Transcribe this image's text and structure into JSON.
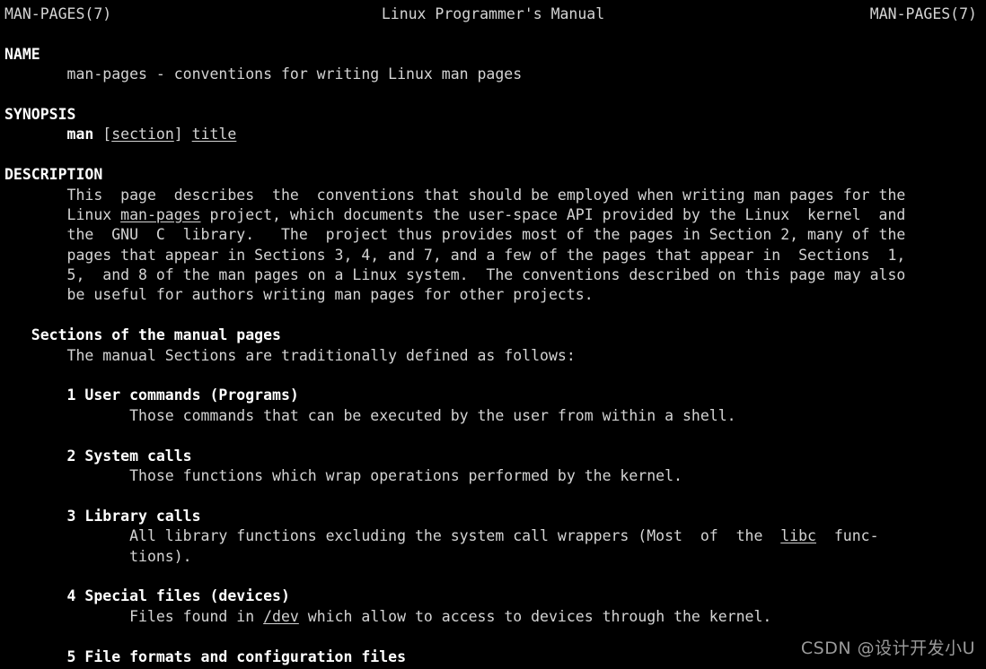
{
  "terminal": {
    "background_color": "#000000",
    "text_color": "#d4d4d4",
    "bold_color": "#ffffff"
  },
  "header": {
    "left": "MAN-PAGES(7)",
    "center": "Linux Programmer's Manual",
    "right": "MAN-PAGES(7)"
  },
  "sections": {
    "name_heading": "NAME",
    "name_body": "       man-pages - conventions for writing Linux man pages",
    "synopsis_heading": "SYNOPSIS",
    "synopsis_man": "man",
    "synopsis_bracket_open": " [",
    "synopsis_section": "section",
    "synopsis_bracket_close": "] ",
    "synopsis_title": "title",
    "description_heading": "DESCRIPTION",
    "description_line1": "       This  page  describes  the  conventions that should be employed when writing man pages for the",
    "description_line2_pre": "       Linux ",
    "description_line2_italic": "man-pages",
    "description_line2_post": " project, which documents the user-space API provided by the Linux  kernel  and",
    "description_line3": "       the  GNU  C  library.   The  project thus provides most of the pages in Section 2, many of the",
    "description_line4": "       pages that appear in Sections 3, 4, and 7, and a few of the pages that appear in  Sections  1,",
    "description_line5": "       5,  and 8 of the man pages on a Linux system.  The conventions described on this page may also",
    "description_line6": "       be useful for authors writing man pages for other projects."
  },
  "subsection": {
    "heading": "   Sections of the manual pages",
    "intro": "       The manual Sections are traditionally defined as follows:"
  },
  "manual_sections": [
    {
      "title": "       1 User commands (Programs)",
      "body": [
        "              Those commands that can be executed by the user from within a shell."
      ]
    },
    {
      "title": "       2 System calls",
      "body": [
        "              Those functions which wrap operations performed by the kernel."
      ]
    },
    {
      "title": "       3 Library calls",
      "body_pre": "              All library functions excluding the system call wrappers (Most  of  the  ",
      "body_italic": "libc",
      "body_post": "  func-",
      "body_cont": "              tions)."
    },
    {
      "title": "       4 Special files (devices)",
      "body_pre": "              Files found in ",
      "body_italic": "/dev",
      "body_post": " which allow to access to devices through the kernel."
    },
    {
      "title": "       5 File formats and configuration files"
    }
  ],
  "watermark": {
    "text": "CSDN @设计开发小U",
    "color": "#9a9a9a"
  }
}
